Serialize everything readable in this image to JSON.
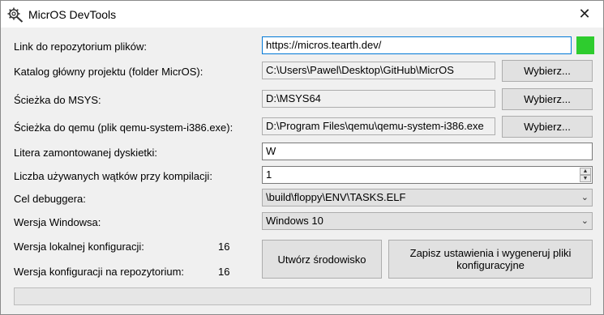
{
  "window": {
    "title": "MicrOS DevTools"
  },
  "form": {
    "repo_link": {
      "label": "Link do repozytorium plików:",
      "value": "https://micros.tearth.dev/",
      "status_color": "#2ecc2e"
    },
    "project_dir": {
      "label": "Katalog główny projektu (folder MicrOS):",
      "value": "C:\\Users\\Pawel\\Desktop\\GitHub\\MicrOS",
      "button": "Wybierz..."
    },
    "msys_path": {
      "label": "Ścieżka do MSYS:",
      "value": "D:\\MSYS64",
      "button": "Wybierz..."
    },
    "qemu_path": {
      "label": "Ścieżka do qemu (plik qemu-system-i386.exe):",
      "value": "D:\\Program Files\\qemu\\qemu-system-i386.exe",
      "button": "Wybierz..."
    },
    "floppy_letter": {
      "label": "Litera zamontowanej dyskietki:",
      "value": "W"
    },
    "threads": {
      "label": "Liczba używanych wątków przy kompilacji:",
      "value": "1"
    },
    "debug_target": {
      "label": "Cel debuggera:",
      "value": "\\build\\floppy\\ENV\\TASKS.ELF"
    },
    "windows_version": {
      "label": "Wersja Windowsa:",
      "value": "Windows 10"
    },
    "local_config": {
      "label": "Wersja lokalnej konfiguracji:",
      "value": "16"
    },
    "repo_config": {
      "label": "Wersja konfiguracji na repozytorium:",
      "value": "16"
    }
  },
  "actions": {
    "create_env": "Utwórz środowisko",
    "save_settings": "Zapisz ustawienia i wygeneruj pliki konfiguracyjne"
  },
  "progress": {
    "value": 0
  }
}
